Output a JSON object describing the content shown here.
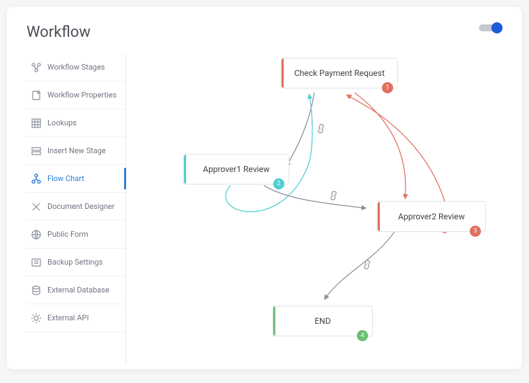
{
  "header": {
    "title": "Workflow"
  },
  "toggle": {
    "on": true
  },
  "sidebar": {
    "items": [
      {
        "label": "Workflow Stages",
        "icon": "stages-icon"
      },
      {
        "label": "Workflow Properties",
        "icon": "properties-icon"
      },
      {
        "label": "Lookups",
        "icon": "lookups-icon"
      },
      {
        "label": "Insert New Stage",
        "icon": "insert-stage-icon"
      },
      {
        "label": "Flow Chart",
        "icon": "flowchart-icon",
        "active": true
      },
      {
        "label": "Document Designer",
        "icon": "document-designer-icon"
      },
      {
        "label": "Public Form",
        "icon": "public-form-icon"
      },
      {
        "label": "Backup Settings",
        "icon": "backup-icon"
      },
      {
        "label": "External Database",
        "icon": "database-icon"
      },
      {
        "label": "External API",
        "icon": "api-icon"
      }
    ]
  },
  "diagram": {
    "nodes": [
      {
        "id": 1,
        "label": "Check Payment Request",
        "color": "red",
        "badge": "1"
      },
      {
        "id": 2,
        "label": "Approver1 Review",
        "color": "teal",
        "badge": "2"
      },
      {
        "id": 3,
        "label": "Approver2 Review",
        "color": "red",
        "badge": "3"
      },
      {
        "id": 4,
        "label": "END",
        "color": "green",
        "badge": "4"
      }
    ],
    "edges": [
      {
        "from": 1,
        "to": 2,
        "color": "gray"
      },
      {
        "from": 2,
        "to": 1,
        "color": "teal"
      },
      {
        "from": 2,
        "to": 3,
        "color": "gray"
      },
      {
        "from": 1,
        "to": 3,
        "color": "red"
      },
      {
        "from": 3,
        "to": 1,
        "color": "red"
      },
      {
        "from": 3,
        "to": 4,
        "color": "gray"
      }
    ],
    "colors": {
      "red": "#e07060",
      "teal": "#4fcfcf",
      "green": "#6bbf73",
      "gray": "#8a8f9a"
    }
  }
}
